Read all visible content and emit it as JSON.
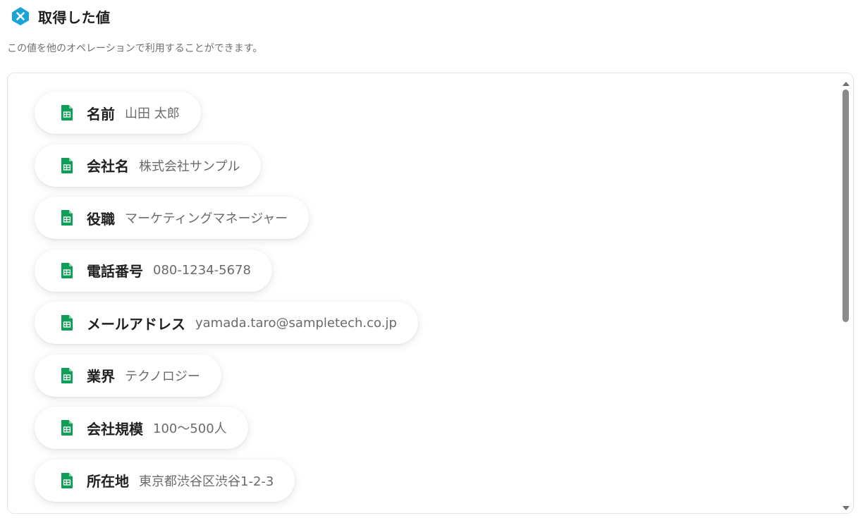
{
  "header": {
    "title": "取得した値",
    "logo_icon": "yoom-x-logo-icon",
    "accent_color": "#1aa3d9"
  },
  "description": "この値を他のオペレーションで利用することができます。",
  "fields": [
    {
      "label": "名前",
      "value": "山田 太郎",
      "icon": "google-sheets-icon"
    },
    {
      "label": "会社名",
      "value": "株式会社サンプル",
      "icon": "google-sheets-icon"
    },
    {
      "label": "役職",
      "value": "マーケティングマネージャー",
      "icon": "google-sheets-icon"
    },
    {
      "label": "電話番号",
      "value": "080-1234-5678",
      "icon": "google-sheets-icon"
    },
    {
      "label": "メールアドレス",
      "value": "yamada.taro@sampletech.co.jp",
      "icon": "google-sheets-icon"
    },
    {
      "label": "業界",
      "value": "テクノロジー",
      "icon": "google-sheets-icon"
    },
    {
      "label": "会社規模",
      "value": "100～500人",
      "icon": "google-sheets-icon"
    },
    {
      "label": "所在地",
      "value": "東京都渋谷区渋谷1-2-3",
      "icon": "google-sheets-icon"
    }
  ],
  "colors": {
    "sheets_green": "#0f9d58",
    "label_text": "#1f1f1f",
    "value_text": "#6b6b6b"
  }
}
